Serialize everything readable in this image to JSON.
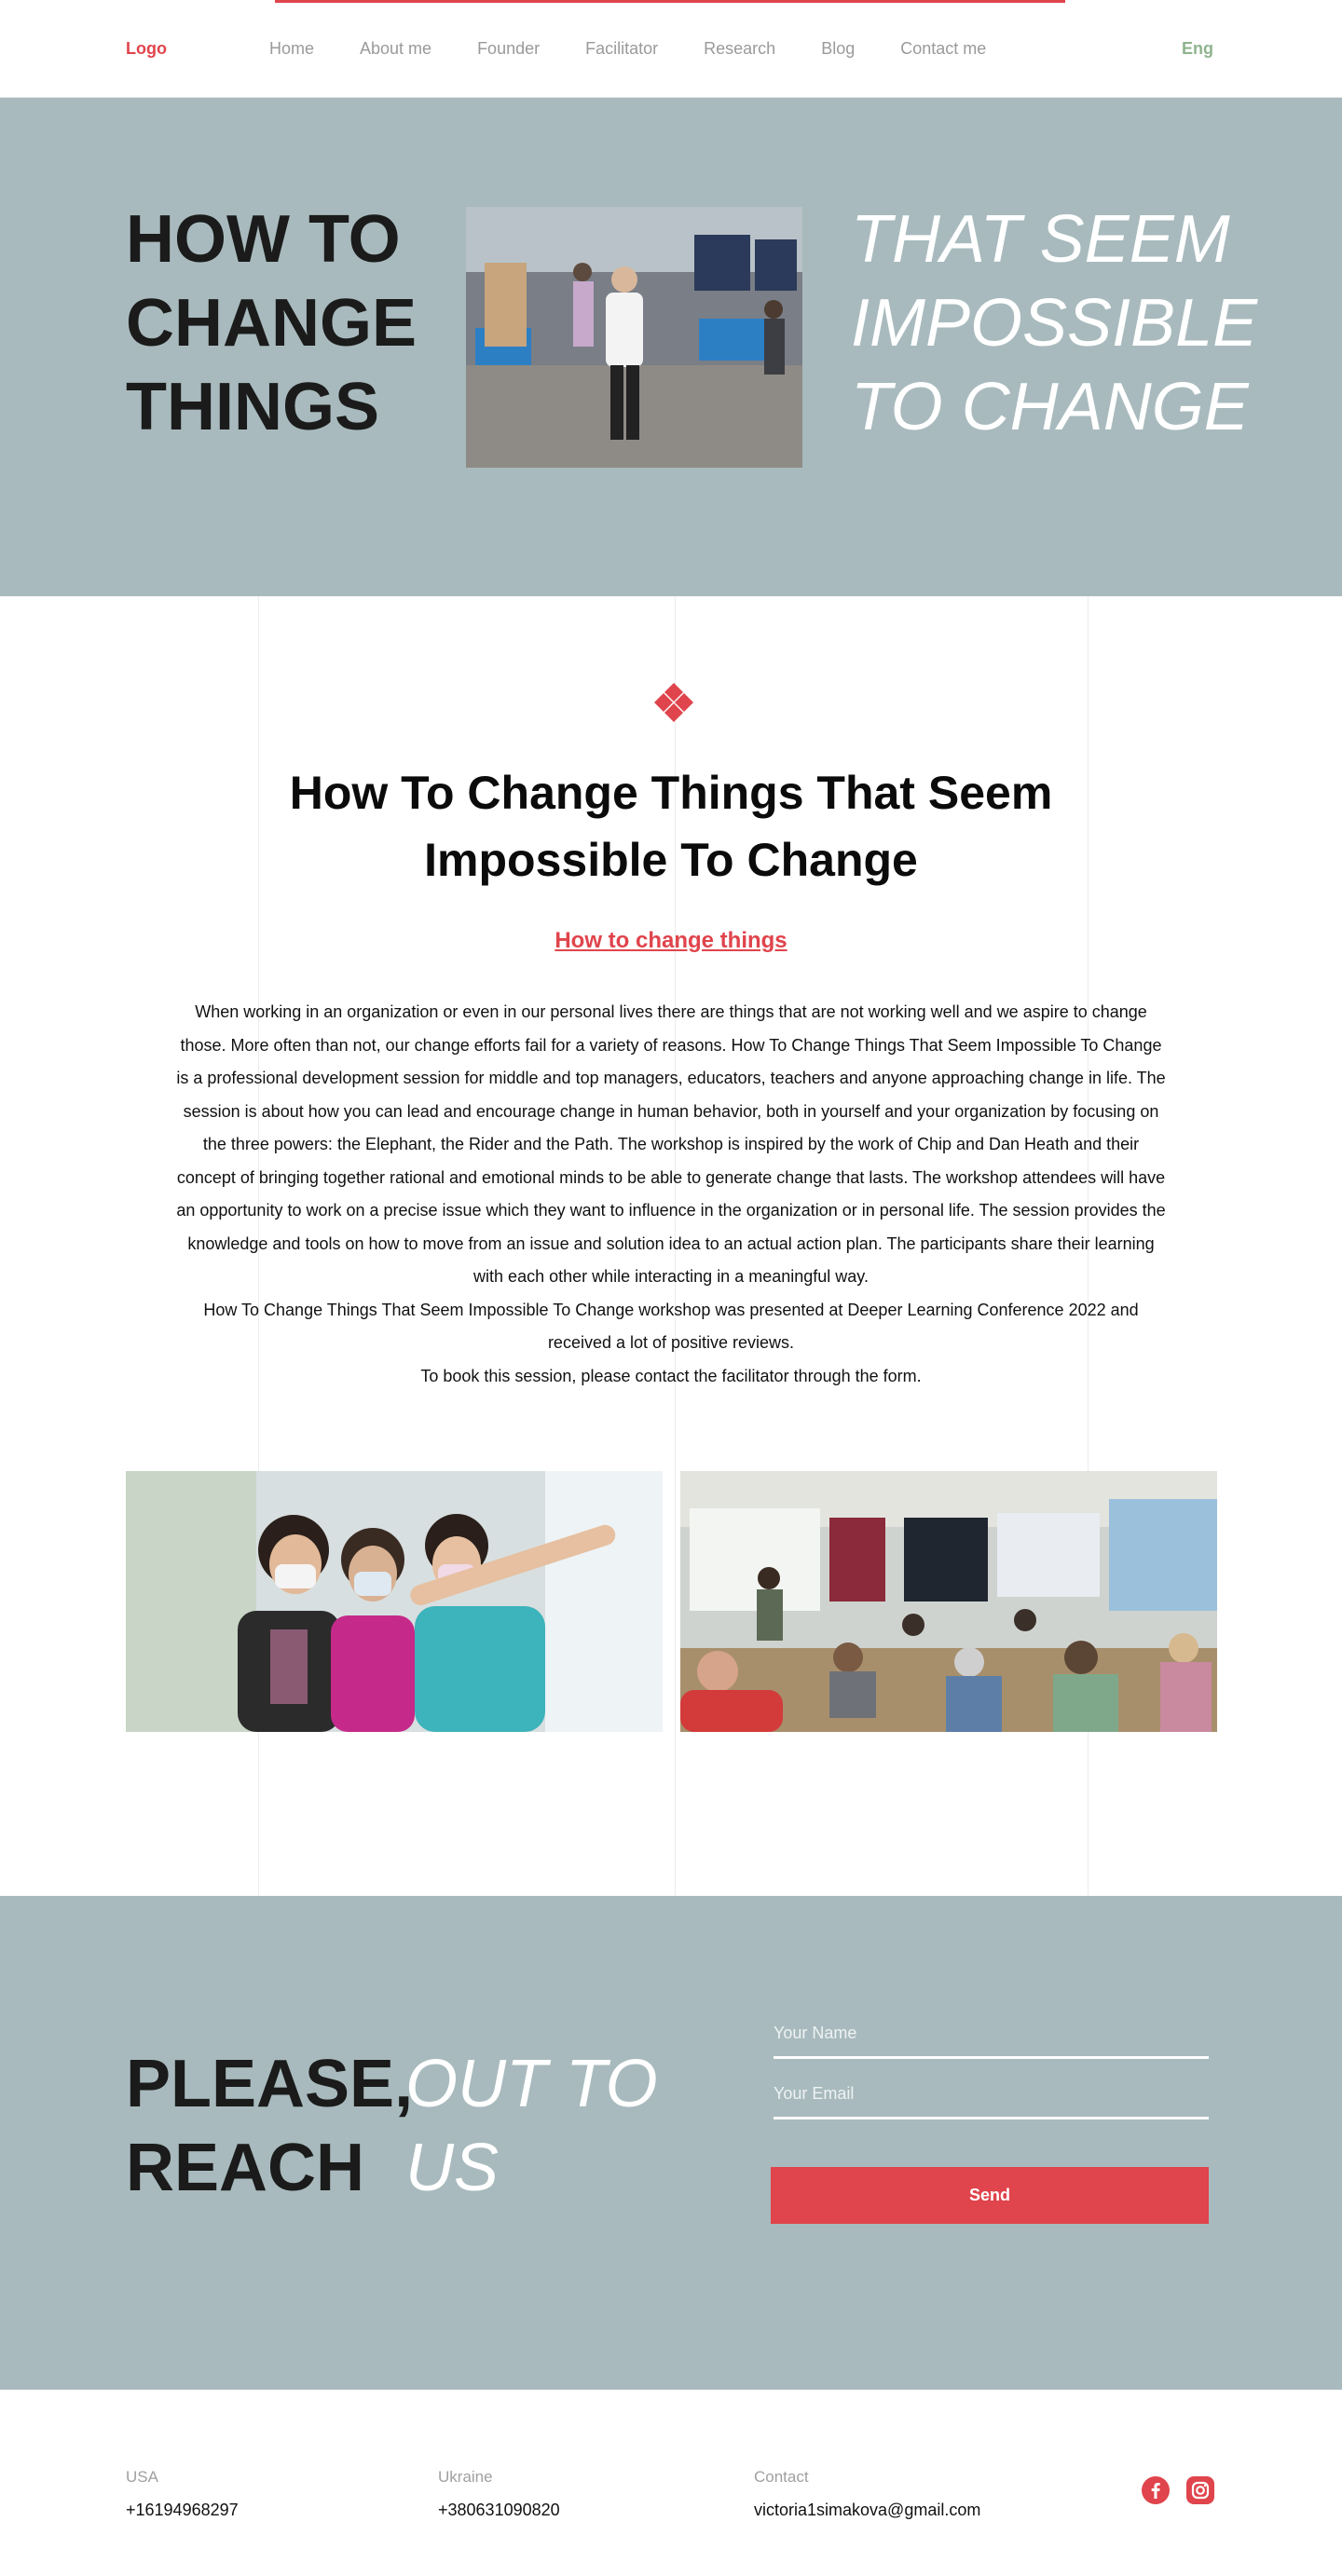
{
  "colors": {
    "accent": "#e0444c",
    "hero_bg": "#a8babd",
    "lang_green": "#8fb48f"
  },
  "nav": {
    "logo": "Logo",
    "links": [
      "Home",
      "About me",
      "Founder",
      "Facilitator",
      "Research",
      "Blog",
      "Contact me"
    ],
    "language": "Eng"
  },
  "hero": {
    "left_heading": "How to change things",
    "right_heading": "That seem impossible to change",
    "photo_alt": "Facilitator at conference exhibit hall"
  },
  "article": {
    "icon": "diamond-cluster-icon",
    "title": "How To Change Things That Seem Impossible To Change",
    "subtitle": "How to change things",
    "paragraph_1": "When working in an organization or even in our personal lives there are things that are not working well and we aspire to change those. More often than not, our change efforts fail for a variety of reasons. How To Change Things That Seem Impossible To Change is a professional development session for middle and top managers, educators, teachers and anyone approaching change in life. The session is about how you can lead and encourage change in human behavior, both in yourself and your organization by focusing on the three powers: the Elephant, the Rider and the Path. The workshop is inspired by the work of Chip and Dan Heath and their concept of bringing together rational and emotional minds to be able to generate change that lasts. The workshop attendees will have an opportunity to work on a precise issue which they want to influence in the organization or in personal life. The session provides the knowledge and tools on how to move from an issue and solution idea to an actual action plan. The participants share their learning with each other while interacting in a meaningful way.",
    "paragraph_2": "How To Change Things That Seem Impossible To Change workshop was presented at Deeper Learning Conference 2022 and received a lot of positive reviews.",
    "paragraph_3": "To book this session, please contact the facilitator through the form.",
    "photo_left_alt": "Three conference attendees with masks",
    "photo_right_alt": "Workshop participants in classroom"
  },
  "contact": {
    "left_heading": "Please, reach",
    "right_heading": "out to us",
    "name_placeholder": "Your Name",
    "email_placeholder": "Your Email",
    "send_label": "Send"
  },
  "footer": {
    "columns": [
      {
        "label": "USA",
        "value": "+16194968297"
      },
      {
        "label": "Ukraine",
        "value": "+380631090820"
      },
      {
        "label": "Contact",
        "value": "victoria1simakova@gmail.com"
      }
    ],
    "social_icons": [
      "facebook-icon",
      "instagram-icon"
    ]
  }
}
